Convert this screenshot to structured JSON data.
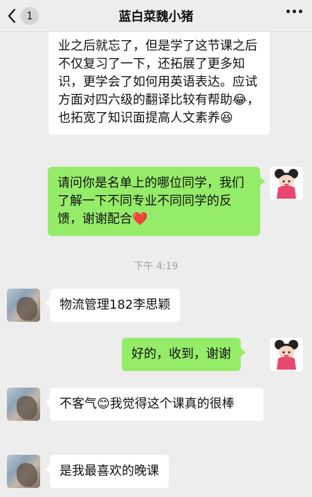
{
  "header": {
    "unread_count": "1",
    "title": "蓝白菜魏小猪"
  },
  "messages": {
    "m1": "业之后就忘了，但是学了这节课之后不仅复习了一下，还拓展了更多知识，更学会了如何用英语表达。应试方面对四六级的翻译比较有帮助😂，也拓宽了知识面提高人文素养😆",
    "m2": "请问你是名单上的哪位同学，我们了解一下不同专业不同同学的反馈，谢谢配合❤️",
    "m3": "物流管理182李思颖",
    "m4": "好的，收到，谢谢",
    "m5": "不客气😊我觉得这个课真的很棒",
    "m6": "是我最喜欢的晚课"
  },
  "timestamp": "下午 4:19"
}
